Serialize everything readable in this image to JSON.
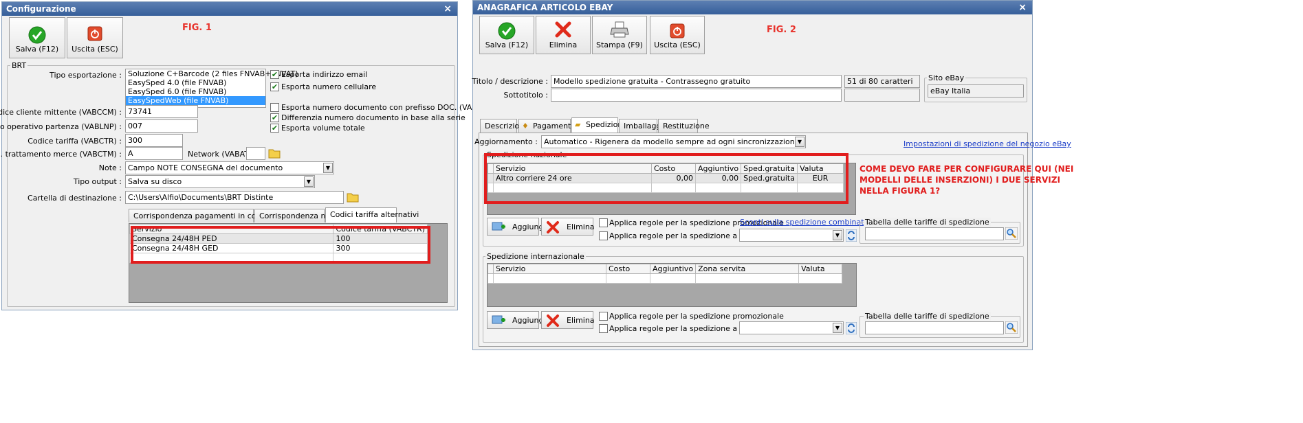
{
  "fig1": {
    "title": "Configurazione",
    "close": "×",
    "fig_label": "FIG. 1",
    "toolbar": {
      "save": "Salva (F12)",
      "exit": "Uscita (ESC)"
    },
    "group_title": "BRT",
    "tipo_esportazione_label": "Tipo esportazione :",
    "tipo_esportazione_options": [
      "Soluzione C+Barcode (2 files FNVAB+FNVAT)",
      "EasySped 4.0 (file FNVAB)",
      "EasySped 6.0 (file FNVAB)",
      "EasySpedWeb (file FNVAB)"
    ],
    "checks": [
      {
        "label": "Esporta indirizzo email",
        "checked": true
      },
      {
        "label": "Esporta numero cellulare",
        "checked": true
      },
      {
        "label": "Esporta numero documento con prefisso DOC. (VABRMA)",
        "checked": false
      },
      {
        "label": "Differenzia numero documento in base alla serie",
        "checked": true
      },
      {
        "label": "Esporta volume totale",
        "checked": true
      }
    ],
    "codice_cliente_label": "Codice cliente mittente (VABCCM) :",
    "codice_cliente_value": "73741",
    "punto_operativo_label": "Punto operativo partenza (VABLNP) :",
    "punto_operativo_value": "007",
    "codice_tariffa_label": "Codice tariffa (VABCTR) :",
    "codice_tariffa_value": "300",
    "cod_trattamento_label": "Cod. trattamento merce (VABCTM) :",
    "cod_trattamento_value": "A",
    "network_label": "Network (VABATB) :",
    "network_value": "",
    "note_label": "Note :",
    "note_value": "Campo NOTE CONSEGNA del documento",
    "tipo_output_label": "Tipo output :",
    "tipo_output_value": "Salva su disco",
    "cartella_label": "Cartella di destinazione :",
    "cartella_value": "C:\\Users\\Alfio\\Documents\\BRT Distinte",
    "tabs": [
      "Corrispondenza pagamenti in contrassegno",
      "Corrispondenza nazioni",
      "Codici tariffa alternativi"
    ],
    "grid_headers": [
      "Servizio",
      "Codice tariffa (VABCTR)"
    ],
    "grid_rows": [
      [
        "Consegna 24/48H PED",
        "100"
      ],
      [
        "Consegna 24/48H GED",
        "300"
      ]
    ]
  },
  "fig2": {
    "title": "ANAGRAFICA ARTICOLO EBAY",
    "close": "×",
    "fig_label": "FIG. 2",
    "toolbar": {
      "save": "Salva (F12)",
      "delete": "Elimina",
      "print": "Stampa (F9)",
      "exit": "Uscita (ESC)"
    },
    "titolo_label": "Titolo / descrizione :",
    "titolo_value": "Modello spedizione gratuita - Contrassegno gratuito",
    "char_count": "51 di 80 caratteri",
    "sottotitolo_label": "Sottotitolo :",
    "sottotitolo_value": "",
    "sito_label": "Sito eBay",
    "sito_value": "eBay Italia",
    "tabs": [
      "Descrizione",
      "Pagamento",
      "Spedizione",
      "Imballaggio",
      "Restituzione"
    ],
    "aggiornamento_label": "Aggiornamento :",
    "aggiornamento_value": "Automatico - Rigenera da modello sempre ad ogni sincronizzazione",
    "impostazioni_link": "Impostazioni di spedizione del negozio eBay",
    "naz_group_title": "Spedizione nazionale",
    "naz_headers": [
      "Servizio",
      "Costo",
      "Aggiuntivo",
      "Sped.gratuita",
      "Valuta"
    ],
    "naz_rows": [
      [
        "Altro corriere 24 ore",
        "0,00",
        "0,00",
        "Sped.gratuita",
        "EUR"
      ]
    ],
    "add_label": "Aggiungi",
    "delete_label": "Elimina",
    "promo_check": "Applica regole per la spedizione promozionale",
    "fisso_check": "Applica regole per la spedizione a prezzo fisso",
    "sconti_link": "Sconti sulla spedizione combinata",
    "tariffe_group": "Tabella delle tariffe di spedizione",
    "int_group_title": "Spedizione internazionale",
    "int_headers": [
      "Servizio",
      "Costo",
      "Aggiuntivo",
      "Zona servita",
      "Valuta"
    ],
    "annotation": "COME DEVO FARE PER CONFIGURARE QUI (NEI MODELLI DELLE INSERZIONI) I DUE SERVIZI NELLA FIGURA 1?"
  },
  "colors": {
    "red_highlight": "#e11d1d",
    "title_bar": "#4a6fa5",
    "selection": "#3399ff"
  }
}
